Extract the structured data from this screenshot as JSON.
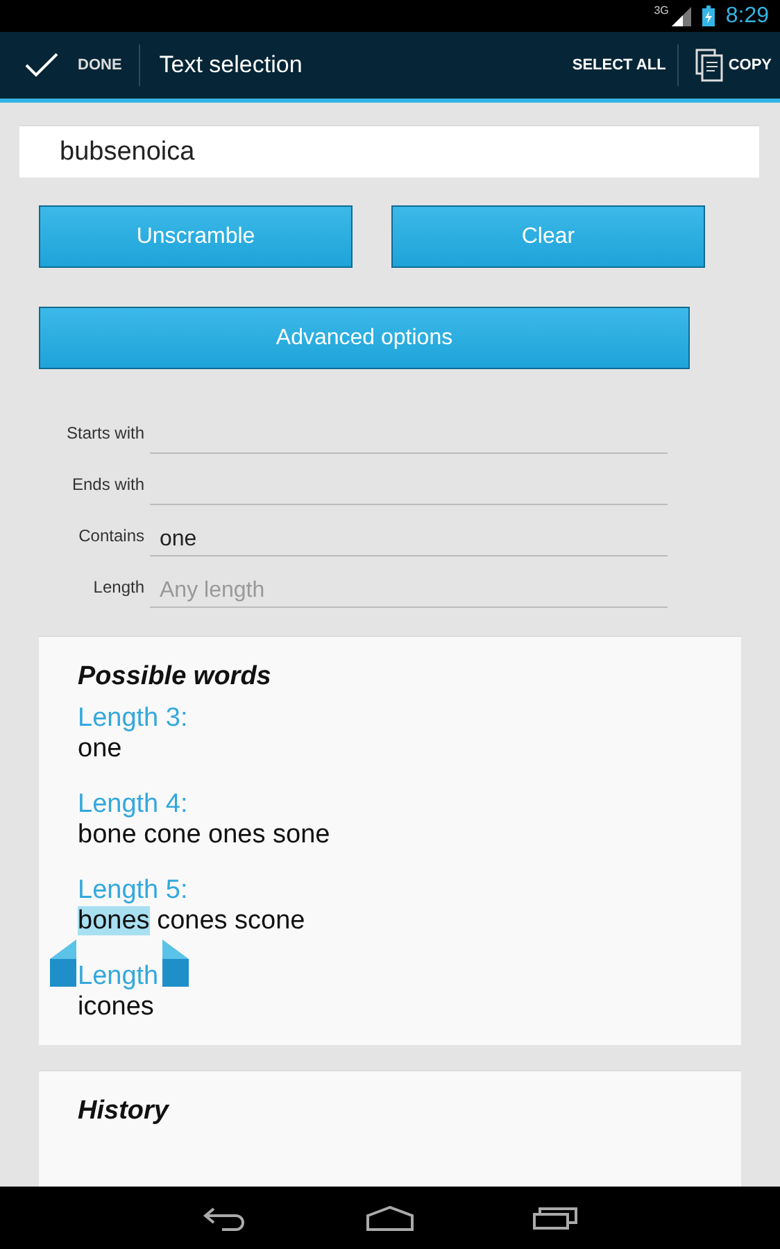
{
  "status_bar": {
    "network": "3G",
    "time": "8:29"
  },
  "action_bar": {
    "done": "DONE",
    "title": "Text selection",
    "select_all": "SELECT ALL",
    "copy": "COPY"
  },
  "input": {
    "value": "bubsenoica"
  },
  "buttons": {
    "unscramble": "Unscramble",
    "clear": "Clear",
    "advanced": "Advanced options"
  },
  "options": [
    {
      "label": "Starts with"
    },
    {
      "label": "Ends with"
    },
    {
      "label": "Contains",
      "value": "one"
    },
    {
      "label": "Length",
      "placeholder": "Any length"
    }
  ],
  "results": {
    "title": "Possible words",
    "groups": [
      {
        "heading": "Length 3:",
        "words": [
          {
            "text": "one",
            "selected": false
          }
        ]
      },
      {
        "heading": "Length 4:",
        "words": [
          {
            "text": "bone",
            "selected": false
          },
          {
            "text": "cone",
            "selected": false
          },
          {
            "text": "ones",
            "selected": false
          },
          {
            "text": "sone",
            "selected": false
          }
        ]
      },
      {
        "heading": "Length 5:",
        "words": [
          {
            "text": "bones",
            "selected": true
          },
          {
            "text": "cones",
            "selected": false
          },
          {
            "text": "scone",
            "selected": false
          }
        ]
      },
      {
        "heading": "Length",
        "words": [
          {
            "text": "icones",
            "selected": false
          }
        ]
      }
    ]
  },
  "history": {
    "title": "History"
  }
}
